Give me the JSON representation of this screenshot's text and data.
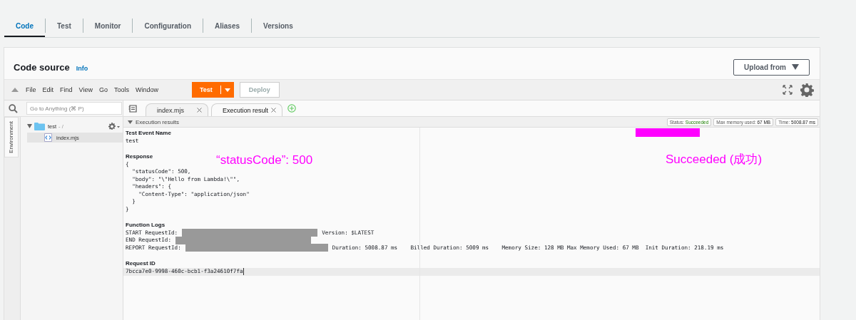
{
  "tabs": [
    {
      "label": "Code",
      "selected": true
    },
    {
      "label": "Test",
      "selected": false
    },
    {
      "label": "Monitor",
      "selected": false
    },
    {
      "label": "Configuration",
      "selected": false
    },
    {
      "label": "Aliases",
      "selected": false
    },
    {
      "label": "Versions",
      "selected": false
    }
  ],
  "panel": {
    "title": "Code source",
    "info_link": "Info",
    "upload_button": "Upload from"
  },
  "toolbar": {
    "menus": [
      "File",
      "Edit",
      "Find",
      "View",
      "Go",
      "Tools",
      "Window"
    ],
    "test_button": "Test",
    "deploy_button": {
      "label": "Deploy",
      "disabled": true
    }
  },
  "sidebar": {
    "search": {
      "placeholder": "Go to Anything (⌘ P)"
    },
    "side_tab": "Environment",
    "tree": [
      {
        "name": "test",
        "path": "- /",
        "expanded": true,
        "children": [
          {
            "name": "index.mjs",
            "selected": true
          }
        ]
      }
    ]
  },
  "editor_tabs": [
    {
      "label": "index.mjs",
      "selected": false
    },
    {
      "label": "Execution result",
      "selected": true
    }
  ],
  "results": {
    "header": "Execution results",
    "status": [
      {
        "label": "Status:",
        "value": "Succeeded",
        "kind": "status"
      },
      {
        "label": "Max memory used:",
        "value": "67 MB",
        "kind": "plain"
      },
      {
        "label": "Time:",
        "value": "5008.87 ms",
        "kind": "plain"
      }
    ],
    "event_heading": "Test Event Name",
    "event_name": "test",
    "response_heading": "Response",
    "response_lines": [
      "{",
      "  \"statusCode\": 500,",
      "  \"body\": \"\\\"Hello from Lambda!\\\"\",",
      "  \"headers\": {",
      "    \"Content-Type\": \"application/json\"",
      "  }",
      "}"
    ],
    "logs_heading": "Function Logs",
    "log_lines": [
      {
        "prefix": "START RequestId:",
        "redacted": true,
        "suffix": "Version: $LATEST"
      },
      {
        "prefix": "END RequestId:",
        "redacted": true
      },
      {
        "prefix": "REPORT RequestId:",
        "redacted": true,
        "suffix": "Duration: 5008.87 ms    Billed Duration: 5009 ms    Memory Size: 128 MB Max Memory Used: 67 MB  Init Duration: 218.19 ms"
      }
    ],
    "request_heading": "Request ID",
    "request_id": "7bcca7e0-9998-460c-bcb1-f3a24610f7fa"
  },
  "annotations": [
    {
      "kind": "text",
      "text": "“statusCode”: 500"
    },
    {
      "kind": "text",
      "text": "Succeeded (成功)"
    },
    {
      "kind": "highlight"
    }
  ]
}
